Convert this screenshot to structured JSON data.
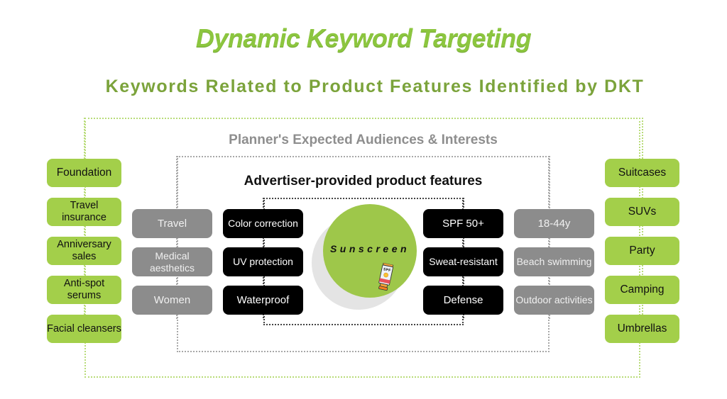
{
  "header": {
    "title": "Dynamic Keyword Targeting",
    "subtitle": "Keywords Related to Product Features Identified by DKT"
  },
  "sections": {
    "planner_label": "Planner's Expected Audiences & Interests",
    "advertiser_label": "Advertiser-provided product features"
  },
  "product": {
    "name": "Sunscreen",
    "icon": "sunscreen-tube-icon"
  },
  "dkt_keywords_left": [
    "Foundation",
    "Travel insurance",
    "Anniversary sales",
    "Anti-spot serums",
    "Facial cleansers"
  ],
  "dkt_keywords_right": [
    "Suitcases",
    "SUVs",
    "Party",
    "Camping",
    "Umbrellas"
  ],
  "planner_left": [
    "Travel",
    "Medical aesthetics",
    "Women"
  ],
  "planner_right": [
    "18-44y",
    "Beach swimming",
    "Outdoor activities"
  ],
  "features_left": [
    "Color correction",
    "UV protection",
    "Waterproof"
  ],
  "features_right": [
    "SPF 50+",
    "Sweat-resistant",
    "Defense"
  ],
  "colors": {
    "dkt_green": "#A3CF4A",
    "title_green": "#8CC63F",
    "subtitle_green": "#7BA33B",
    "planner_gray": "#8C8C8C",
    "feature_black": "#000000",
    "product_circle": "#9EC74A"
  }
}
